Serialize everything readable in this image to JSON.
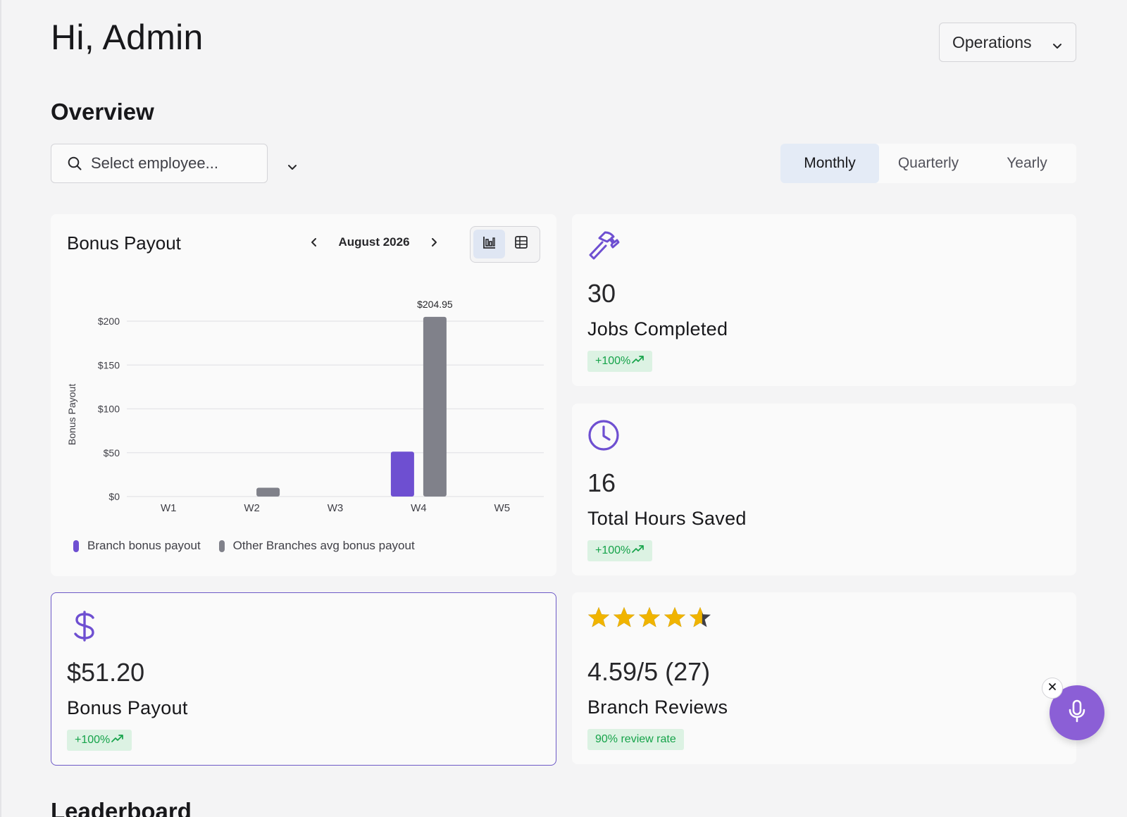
{
  "header": {
    "greeting": "Hi, Admin",
    "department": "Operations"
  },
  "overview": {
    "title": "Overview",
    "employee_placeholder": "Select employee...",
    "periods": [
      "Monthly",
      "Quarterly",
      "Yearly"
    ],
    "active_period": "Monthly"
  },
  "bonus_chart_card": {
    "title": "Bonus Payout",
    "month": "August 2026",
    "views": [
      "chart-icon",
      "table-icon"
    ],
    "active_view": "chart-icon"
  },
  "chart_data": {
    "type": "bar",
    "categories": [
      "W1",
      "W2",
      "W3",
      "W4",
      "W5"
    ],
    "series": [
      {
        "name": "Branch bonus payout",
        "color": "#6e4fd1",
        "values": [
          0,
          0,
          0,
          51.2,
          0
        ]
      },
      {
        "name": "Other Branches avg bonus payout",
        "color": "#80818a",
        "values": [
          0,
          10,
          0,
          204.95,
          0
        ]
      }
    ],
    "y_ticks": [
      "$0",
      "$50",
      "$100",
      "$150",
      "$200"
    ],
    "ylabel": "Bonus Payout",
    "ylim": [
      0,
      200
    ],
    "data_labels": [
      {
        "category": "W4",
        "series": 1,
        "text": "$204.95"
      }
    ],
    "grid": true,
    "legend_position": "bottom-left"
  },
  "stats": {
    "jobs": {
      "value": "30",
      "label": "Jobs Completed",
      "badge": "+100%",
      "icon": "hammer-icon"
    },
    "hours": {
      "value": "16",
      "label": "Total Hours Saved",
      "badge": "+100%",
      "icon": "clock-icon"
    },
    "bonus": {
      "value": "$51.20",
      "label": "Bonus Payout",
      "badge": "+100%",
      "icon": "dollar-icon"
    },
    "reviews": {
      "value": "4.59/5 (27)",
      "label": "Branch Reviews",
      "badge": "90% review rate",
      "rating": 4.59,
      "icon": "star-icon"
    }
  },
  "colors": {
    "accent": "#6e4fd1",
    "positive": "#16a34a",
    "positive_bg": "#dcf2e3",
    "star": "#f0b400"
  },
  "voice": {
    "icon": "microphone-icon",
    "close_icon": "close-icon"
  },
  "leaderboard": {
    "title": "Leaderboard"
  }
}
